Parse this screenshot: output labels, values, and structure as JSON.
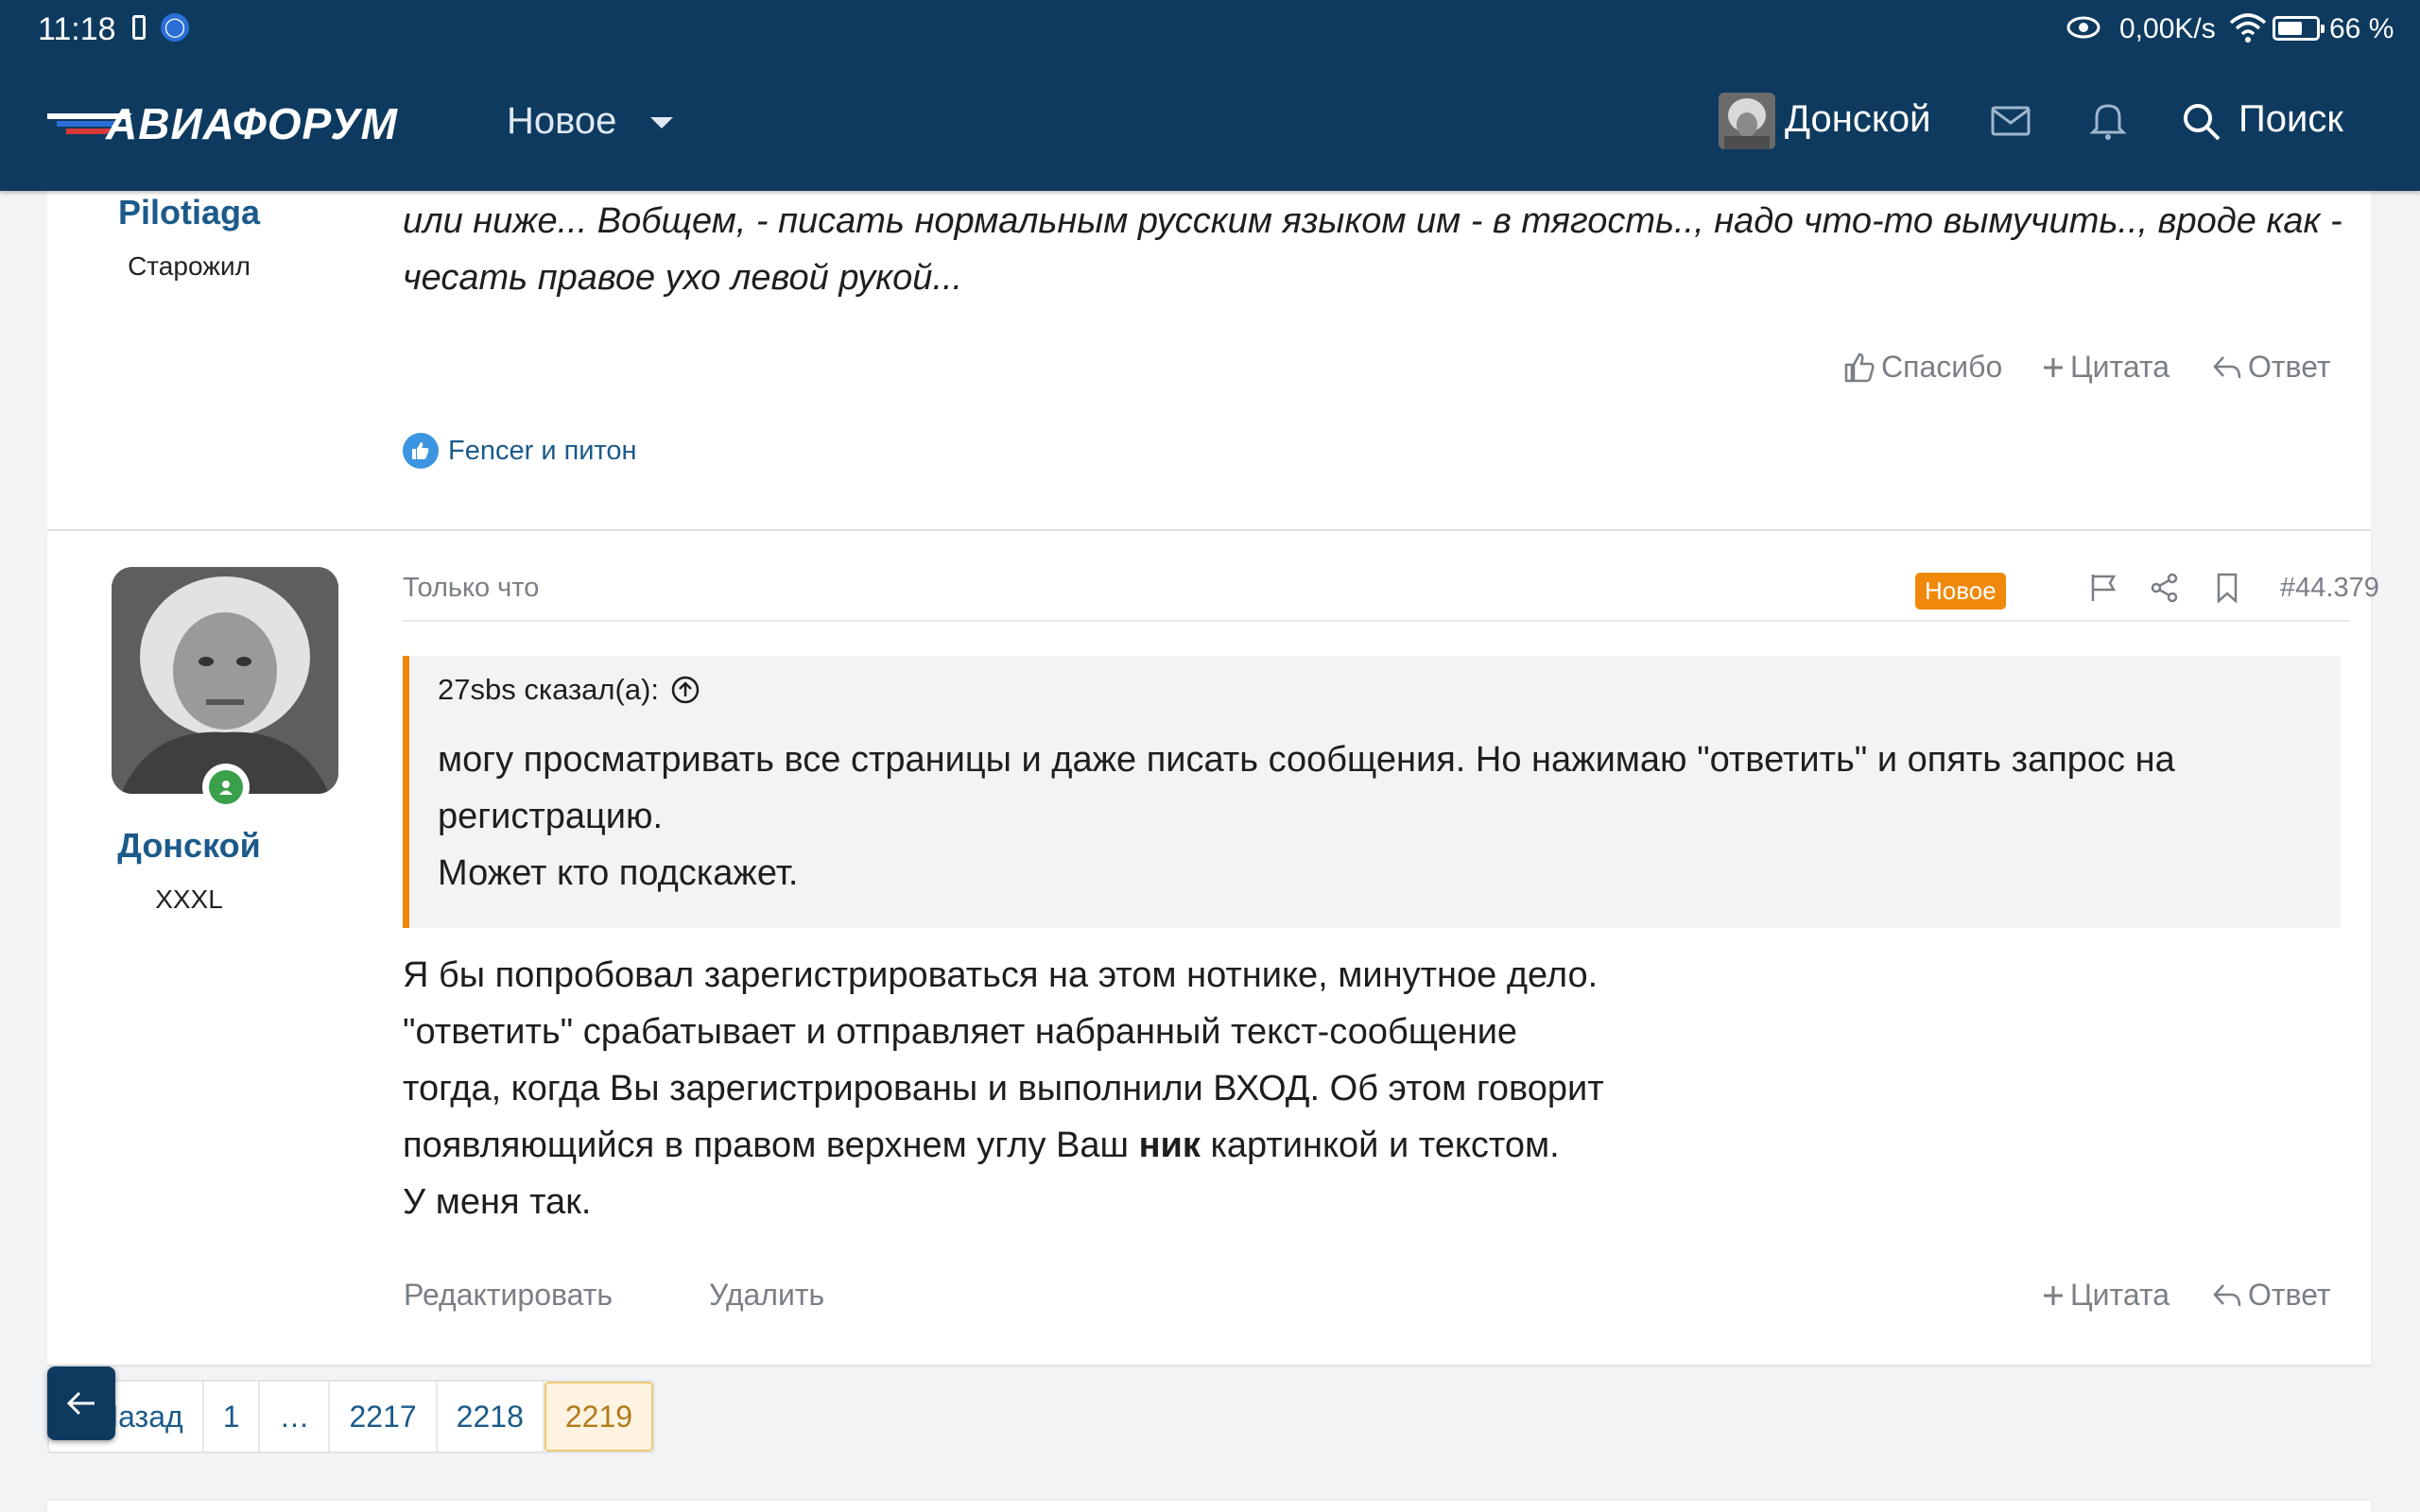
{
  "status_bar": {
    "time": "11:18",
    "net_speed": "0,00K/s",
    "battery": "66 %",
    "battery_level": 0.66
  },
  "nav": {
    "logo": "АВИАФОРУМ",
    "new_label": "Новое",
    "username": "Донской",
    "search_label": "Поиск"
  },
  "post1": {
    "author": "Pilotiaga",
    "author_title": "Старожил",
    "text": "или ниже... Вобщем, - писать нормальным русским языком им - в тягость.., надо что-то вымучить.., вроде как - чесать правое ухо левой рукой...",
    "actions": {
      "thanks": "Спасибо",
      "quote": "Цитата",
      "reply": "Ответ"
    },
    "reactions": "Fencer и питон"
  },
  "post2": {
    "author": "Донской",
    "author_title": "XXXL",
    "time": "Только что",
    "badge": "Новое",
    "number": "#44.379",
    "quote": {
      "author_line": "27sbs сказал(а):",
      "lines": [
        "могу просматривать все страницы и даже писать сообщения. Но нажимаю \"ответить\" и опять запрос на",
        "регистрацию.",
        "Может кто подскажет."
      ]
    },
    "body": {
      "line1": "Я бы попробовал зарегистрироваться на этом нотнике, минутное дело.",
      "line2": "\"ответить\" срабатывает и отправляет набранный текст-сообщение",
      "line3": "тогда, когда Вы зарегистрированы и выполнили ВХОД. Об этом говорит",
      "line4_before": "появляющийся в правом верхнем углу Ваш ",
      "line4_bold": "ник",
      "line4_after": " картинкой и текстом.",
      "line5": "У меня так."
    },
    "actions": {
      "edit": "Редактировать",
      "delete": "Удалить",
      "quote": "Цитата",
      "reply": "Ответ"
    }
  },
  "pagination": {
    "back": "Назад",
    "pages": [
      "1",
      "…",
      "2217",
      "2218",
      "2219"
    ],
    "current": "2219"
  },
  "colors": {
    "nav_bg": "#0e3a5f",
    "accent": "#f0890b",
    "link": "#1b5a8a"
  }
}
